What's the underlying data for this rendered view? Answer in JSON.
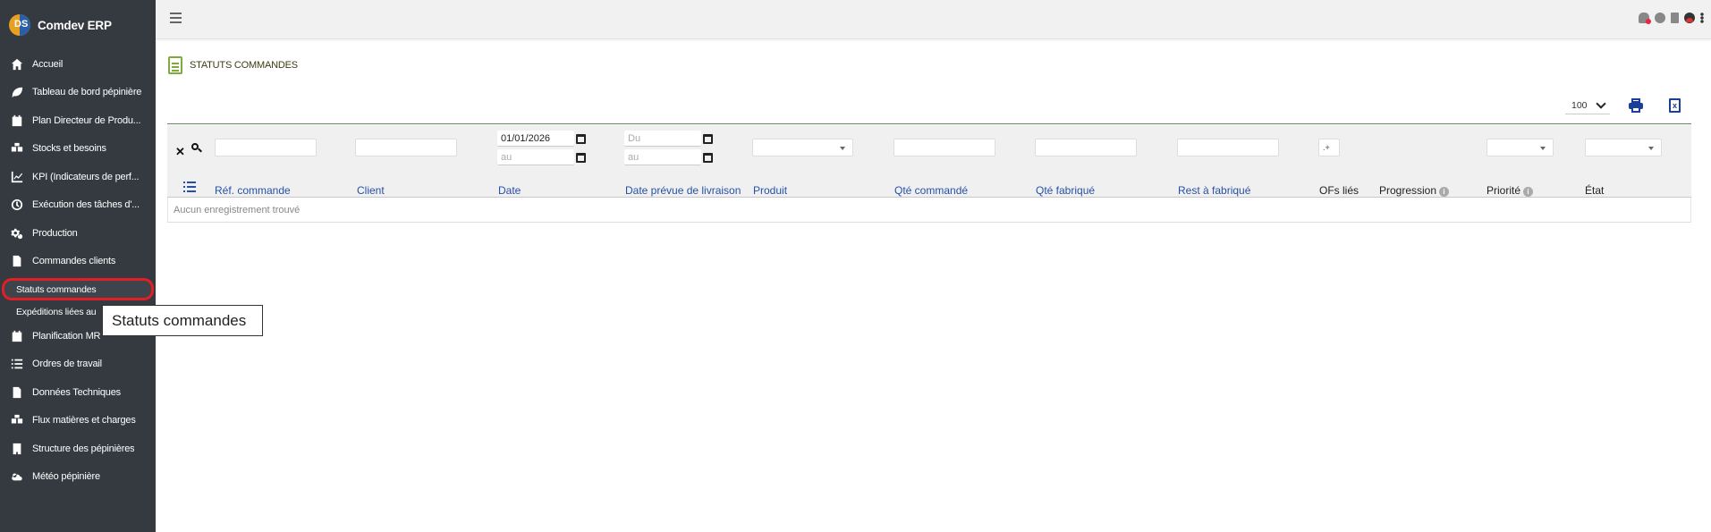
{
  "app": {
    "title": "Comdev ERP",
    "logo_letters": "DS"
  },
  "sidebar": {
    "items": [
      {
        "label": "Accueil",
        "icon": "home-icon"
      },
      {
        "label": "Tableau de bord pépinière",
        "icon": "leaf-icon"
      },
      {
        "label": "Plan Directeur de Produ...",
        "icon": "calendar-icon"
      },
      {
        "label": "Stocks et besoins",
        "icon": "boxes-icon"
      },
      {
        "label": "KPI (Indicateurs de perf...",
        "icon": "chart-line-icon"
      },
      {
        "label": "Exécution des tâches d'...",
        "icon": "clock-icon"
      },
      {
        "label": "Production",
        "icon": "gears-icon"
      },
      {
        "label": "Commandes clients",
        "icon": "file-icon"
      }
    ],
    "subitems": [
      {
        "label": "Statuts commandes",
        "active": true
      },
      {
        "label": "Expéditions liées au"
      }
    ],
    "items_after": [
      {
        "label": "Planification MR",
        "icon": "calendar-icon"
      },
      {
        "label": "Ordres de travail",
        "icon": "list-check-icon"
      },
      {
        "label": "Données Techniques",
        "icon": "file-icon"
      },
      {
        "label": "Flux matières et charges",
        "icon": "boxes-icon"
      },
      {
        "label": "Structure des pépinières",
        "icon": "building-icon"
      },
      {
        "label": "Météo pépinière",
        "icon": "cloud-sun-icon"
      }
    ]
  },
  "tooltip": {
    "text": "Statuts commandes"
  },
  "page": {
    "title": "STATUTS COMMANDES"
  },
  "toolbar": {
    "page_size": "100",
    "excel_glyph": "x"
  },
  "filters": {
    "date_from": "01/01/2026",
    "date_to_placeholder": "au",
    "delivery_from_placeholder": "Du",
    "delivery_to_placeholder": "au",
    "ofs_select": ".+"
  },
  "table": {
    "columns": {
      "ref": "Réf. commande",
      "client": "Client",
      "date": "Date",
      "delivery": "Date prévue de livraison",
      "product": "Produit",
      "qty_ordered": "Qté commandé",
      "qty_made": "Qté fabriqué",
      "qty_left": "Rest à fabriqué",
      "ofs": "OFs liés",
      "progress": "Progression",
      "priority": "Priorité",
      "state": "État"
    },
    "empty_message": "Aucun enregistrement trouvé"
  },
  "colors": {
    "sidebar_bg": "#343a40",
    "accent_blue": "#2650a8",
    "highlight_red": "#e31e24",
    "page_icon_green": "#7cad3a"
  }
}
